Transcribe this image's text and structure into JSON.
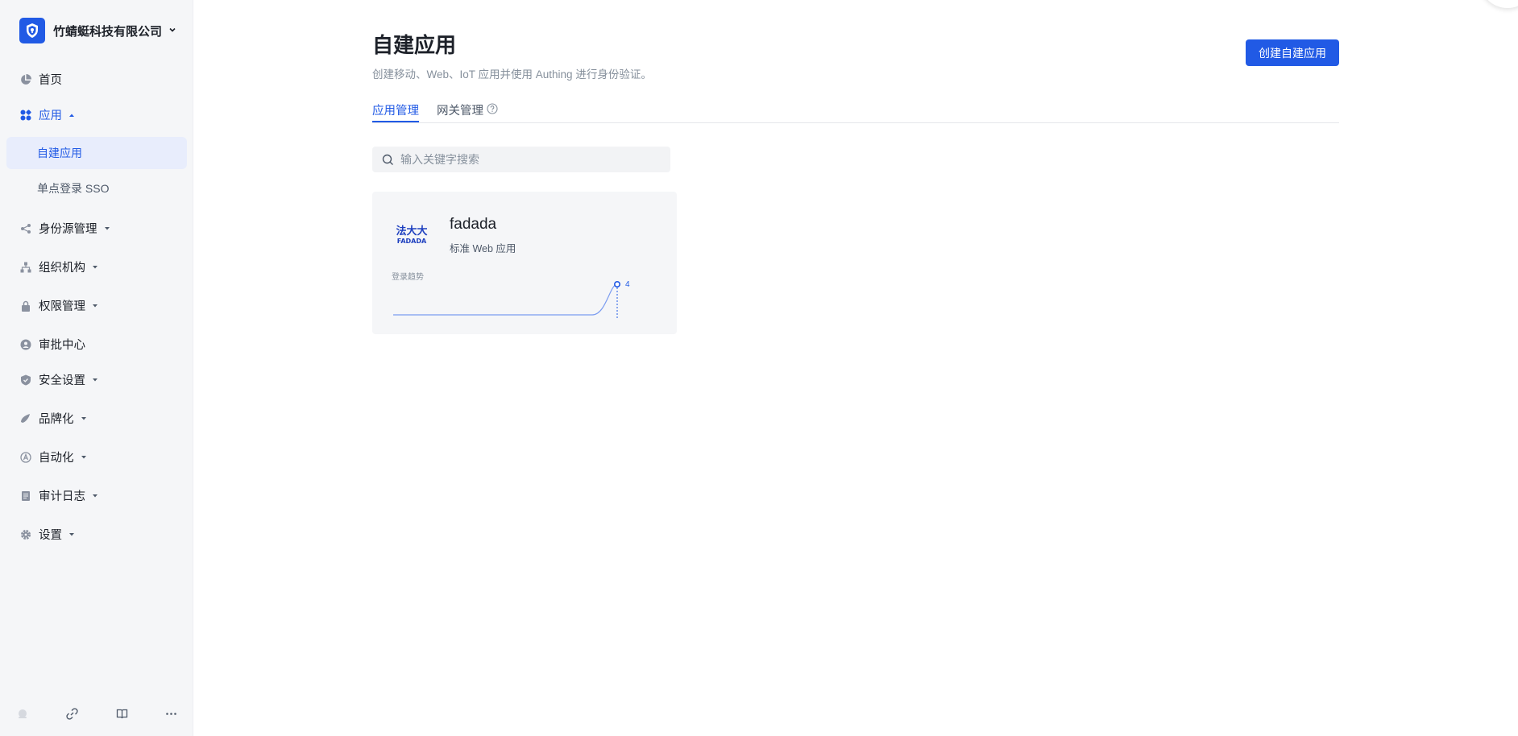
{
  "org": {
    "name": "竹蜻蜓科技有限公司"
  },
  "nav": {
    "home": "首页",
    "apps": "应用",
    "apps_sub": {
      "custom": "自建应用",
      "sso": "单点登录 SSO"
    },
    "identity": "身份源管理",
    "org_structure": "组织机构",
    "permissions": "权限管理",
    "approval": "审批中心",
    "security": "安全设置",
    "branding": "品牌化",
    "automation": "自动化",
    "audit": "审计日志",
    "settings": "设置"
  },
  "main": {
    "title": "自建应用",
    "description": "创建移动、Web、IoT 应用并使用 Authing 进行身份验证。",
    "create_button": "创建自建应用",
    "tabs": [
      {
        "label": "应用管理"
      },
      {
        "label": "网关管理"
      }
    ],
    "search": {
      "placeholder": "输入关键字搜索"
    }
  },
  "apps": [
    {
      "logo_text": "法大大",
      "logo_subtext": "FADADA",
      "name": "fadada",
      "type": "标准 Web 应用",
      "trend_label": "登录趋势",
      "trend_values": [
        0,
        0,
        0,
        0,
        0,
        0,
        0,
        0,
        0,
        4
      ],
      "trend_last_value": "4"
    }
  ],
  "colors": {
    "accent": "#215ae5",
    "sidebar_bg": "#f5f6f8",
    "active_bg": "#e8edfc"
  }
}
